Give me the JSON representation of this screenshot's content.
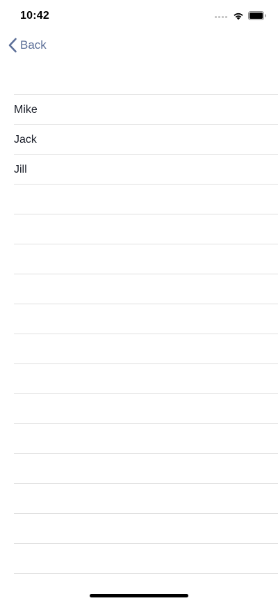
{
  "status_bar": {
    "time": "10:42"
  },
  "nav": {
    "back_label": "Back",
    "accent_color": "#5c6f98"
  },
  "list": {
    "items": [
      "Mike",
      "Jack",
      "Jill"
    ],
    "empty_row_count": 13
  }
}
